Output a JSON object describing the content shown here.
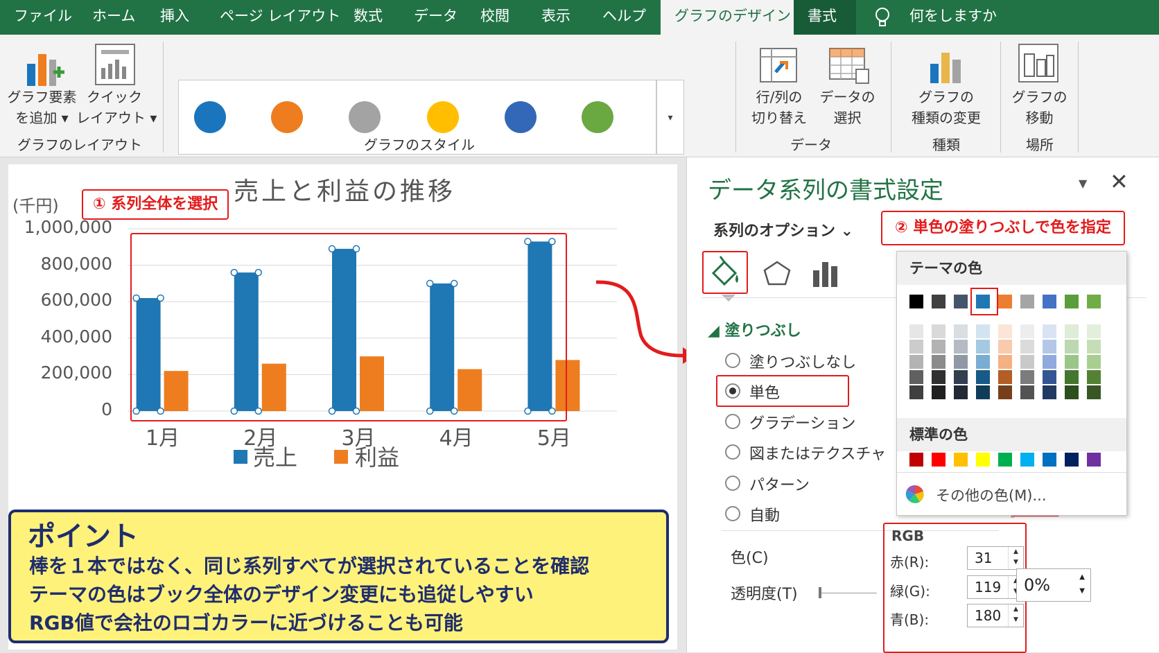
{
  "menubar": {
    "items": [
      "ファイル",
      "ホーム",
      "挿入",
      "ページ レイアウト",
      "数式",
      "データ",
      "校閲",
      "表示",
      "ヘルプ",
      "グラフのデザイン",
      "書式"
    ],
    "search": "何をしますか"
  },
  "ribbon": {
    "add_element": [
      "グラフ要素",
      "を追加"
    ],
    "quick_layout": [
      "クイック",
      "レイアウト"
    ],
    "layout_group": "グラフのレイアウト",
    "style_group": "グラフのスタイル",
    "style_colors": [
      "#1b75bc",
      "#ee7d1f",
      "#a3a3a3",
      "#ffbf00",
      "#3367b8",
      "#6aa842"
    ],
    "switch_row_col": [
      "行/列の",
      "切り替え"
    ],
    "select_data": [
      "データの",
      "選択"
    ],
    "data_group": "データ",
    "change_type": [
      "グラフの",
      "種類の変更"
    ],
    "type_group": "種類",
    "move_chart": [
      "グラフの",
      "移動"
    ],
    "location_group": "場所"
  },
  "chart": {
    "unit": "(千円)",
    "callout1": "① 系列全体を選択",
    "legend": [
      "売上",
      "利益"
    ]
  },
  "chart_data": {
    "type": "bar",
    "title": "売上と利益の推移",
    "categories": [
      "1月",
      "2月",
      "3月",
      "4月",
      "5月"
    ],
    "series": [
      {
        "name": "売上",
        "values": [
          620000,
          760000,
          890000,
          700000,
          930000
        ],
        "color": "#1f77b4"
      },
      {
        "name": "利益",
        "values": [
          220000,
          260000,
          300000,
          230000,
          280000
        ],
        "color": "#ee7d1f"
      }
    ],
    "ylim": [
      0,
      1000000
    ],
    "yticks": [
      "1,000,000",
      "800,000",
      "600,000",
      "400,000",
      "200,000",
      "0"
    ],
    "grid": true,
    "legend_position": "bottom"
  },
  "point": {
    "title": "ポイント",
    "lines": [
      "棒を１本ではなく、同じ系列すべてが選択されていることを確認",
      "テーマの色はブック全体のデザイン変更にも追従しやすい",
      "RGB値で会社のロゴカラーに近づけることも可能"
    ]
  },
  "pane": {
    "title": "データ系列の書式設定",
    "series_options": "系列のオプション",
    "callout2": "② 単色の塗りつぶしで色を指定",
    "fill_section": "塗りつぶし",
    "fill_options": [
      "塗りつぶしなし",
      "単色",
      "グラデーション",
      "図またはテクスチャ",
      "パターン",
      "自動"
    ],
    "selected_option": "単色",
    "color_label": "色(C)",
    "transparency_label": "透明度(T)",
    "transparency_value": "0%"
  },
  "popup": {
    "theme_header": "テーマの色",
    "standard_header": "標準の色",
    "more_colors": "その他の色(M)...",
    "theme_colors": [
      "#000000",
      "#404040",
      "#44546a",
      "#1f77b4",
      "#ed7d31",
      "#a5a5a5",
      "#4472c4",
      "#5a9e3c",
      "#70ad47"
    ],
    "standard_colors": [
      "#c00000",
      "#ff0000",
      "#ffc000",
      "#ffff00",
      "#00b050",
      "#00b0f0",
      "#0070c0",
      "#002060",
      "#7030a0"
    ]
  },
  "rgb": {
    "header": "RGB",
    "red_label": "赤(R):",
    "red": "31",
    "green_label": "緑(G):",
    "green": "119",
    "blue_label": "青(B):",
    "blue": "180"
  }
}
